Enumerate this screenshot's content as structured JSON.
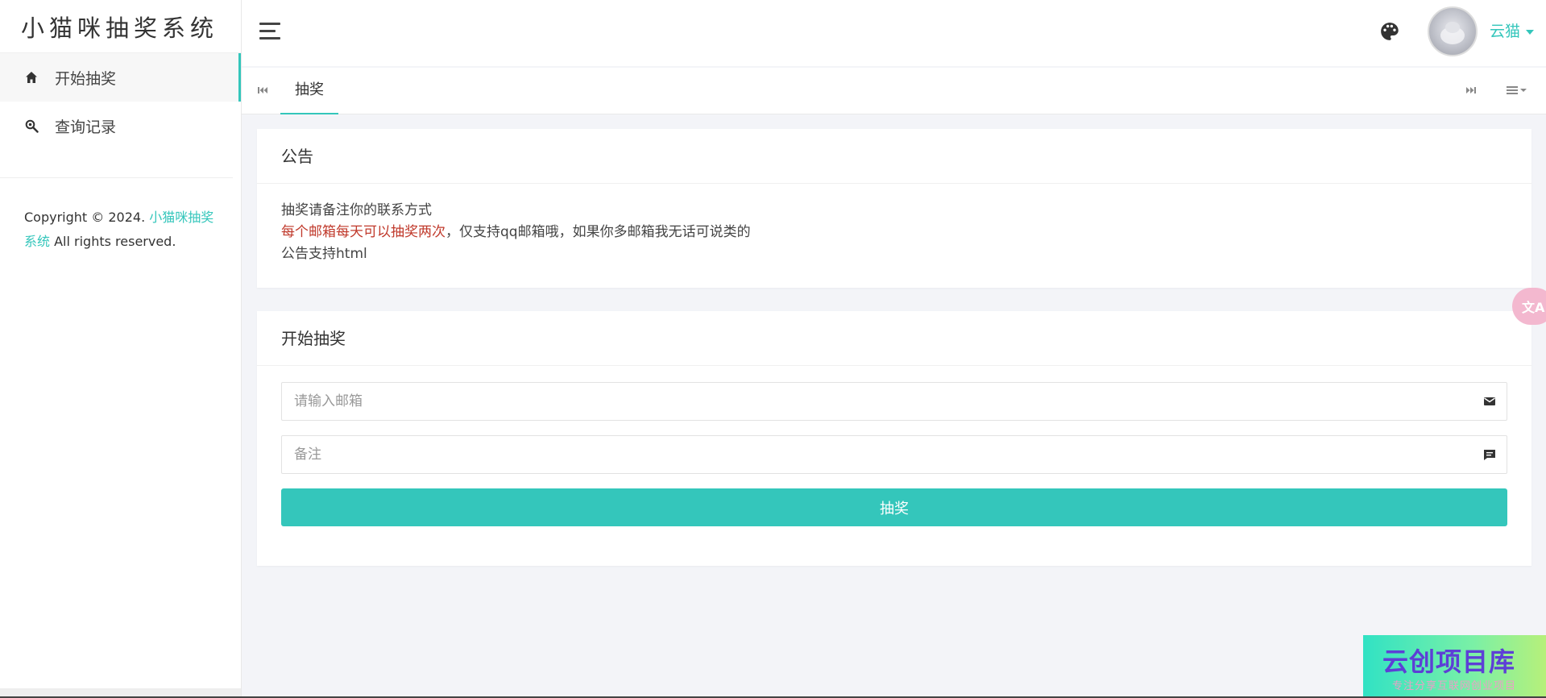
{
  "app": {
    "title": "小猫咪抽奖系统"
  },
  "sidebar": {
    "items": [
      {
        "label": "开始抽奖",
        "icon": "home-icon",
        "active": true
      },
      {
        "label": "查询记录",
        "icon": "search-icon",
        "active": false
      }
    ],
    "copyright_prefix": "Copyright © 2024. ",
    "copyright_link": "小猫咪抽奖系统",
    "copyright_suffix": " All rights reserved."
  },
  "header": {
    "menu_icon": "hamburger-icon",
    "theme_icon": "palette-icon",
    "user_name": "云猫"
  },
  "tabs": [
    {
      "label": "抽奖",
      "active": true
    }
  ],
  "notice": {
    "title": "公告",
    "line1": "抽奖请备注你的联系方式",
    "line2_red": "每个邮箱每天可以抽奖两次",
    "line2_rest": "，仅支持qq邮箱哦，如果你多邮箱我无话可说类的",
    "line3": "公告支持html"
  },
  "form": {
    "title": "开始抽奖",
    "email_placeholder": "请输入邮箱",
    "email_value": "",
    "remark_placeholder": "备注",
    "remark_value": "",
    "submit_label": "抽奖"
  },
  "widgets": {
    "translate_label": "文A"
  },
  "watermark": {
    "title": "云创项目库",
    "subtitle": "专注分享互联网创业项目"
  },
  "colors": {
    "accent": "#34c6bb",
    "notice_red": "#c0392b",
    "background": "#f3f4f8"
  }
}
